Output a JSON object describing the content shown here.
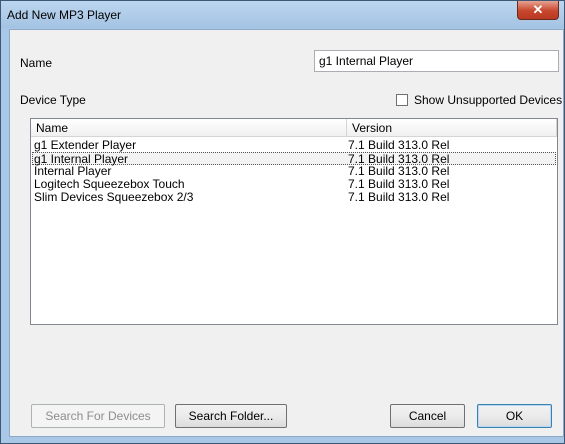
{
  "window": {
    "title": "Add New MP3 Player",
    "close_label": "✕"
  },
  "form": {
    "name_label": "Name",
    "name_value": "g1 Internal Player",
    "device_type_label": "Device Type",
    "show_unsupported_label": "Show Unsupported Devices",
    "show_unsupported_checked": false
  },
  "list": {
    "columns": [
      "Name",
      "Version"
    ],
    "rows": [
      {
        "name": "g1 Extender Player",
        "version": "7.1 Build 313.0 Rel"
      },
      {
        "name": "g1 Internal Player",
        "version": "7.1 Build 313.0 Rel"
      },
      {
        "name": "Internal Player",
        "version": "7.1 Build 313.0 Rel"
      },
      {
        "name": "Logitech Squeezebox Touch",
        "version": "7.1 Build 313.0 Rel"
      },
      {
        "name": "Slim Devices Squeezebox 2/3",
        "version": "7.1 Build 313.0 Rel"
      }
    ],
    "selected_index": 1
  },
  "buttons": {
    "search_devices": "Search For Devices",
    "search_folder": "Search Folder...",
    "cancel": "Cancel",
    "ok": "OK"
  }
}
